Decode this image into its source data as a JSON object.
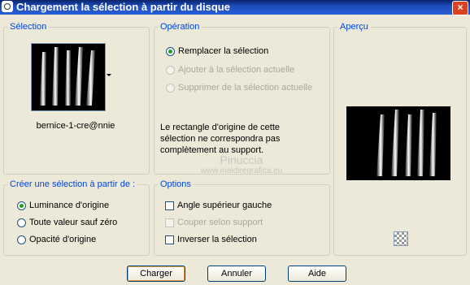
{
  "window": {
    "title": "Chargement la sélection à partir du disque",
    "close_label": "×"
  },
  "selection_group": {
    "title": "Sélection",
    "file_name": "bernice-1-cre@nnie"
  },
  "operation_group": {
    "title": "Opération",
    "options": [
      {
        "label": "Remplacer la sélection",
        "checked": true,
        "enabled": true
      },
      {
        "label": "Ajouter à la sélection actuelle",
        "checked": false,
        "enabled": false
      },
      {
        "label": "Supprimer de la sélection actuelle",
        "checked": false,
        "enabled": false
      }
    ],
    "note": "Le rectangle d'origine de cette sélection ne correspondra pas complètement au support."
  },
  "preview_group": {
    "title": "Aperçu"
  },
  "create_from_group": {
    "title": "Créer une sélection à partir de :",
    "options": [
      {
        "label": "Luminance d'origine",
        "checked": true
      },
      {
        "label": "Toute valeur sauf zéro",
        "checked": false
      },
      {
        "label": "Opacité d'origine",
        "checked": false
      }
    ]
  },
  "options_group": {
    "title": "Options",
    "checkboxes": [
      {
        "label": "Angle supérieur gauche",
        "checked": false,
        "enabled": true
      },
      {
        "label": "Couper selon support",
        "checked": false,
        "enabled": false
      },
      {
        "label": "Inverser la sélection",
        "checked": false,
        "enabled": true
      }
    ]
  },
  "watermark": {
    "line1": "Pinuccia",
    "line2": "www.maidiregrafica.eu"
  },
  "buttons": {
    "load": "Charger",
    "cancel": "Annuler",
    "help": "Aide"
  },
  "icons": {
    "app": "app-icon",
    "dropdown": "chevron-down-icon",
    "preview_toggle": "checkerboard-icon"
  }
}
